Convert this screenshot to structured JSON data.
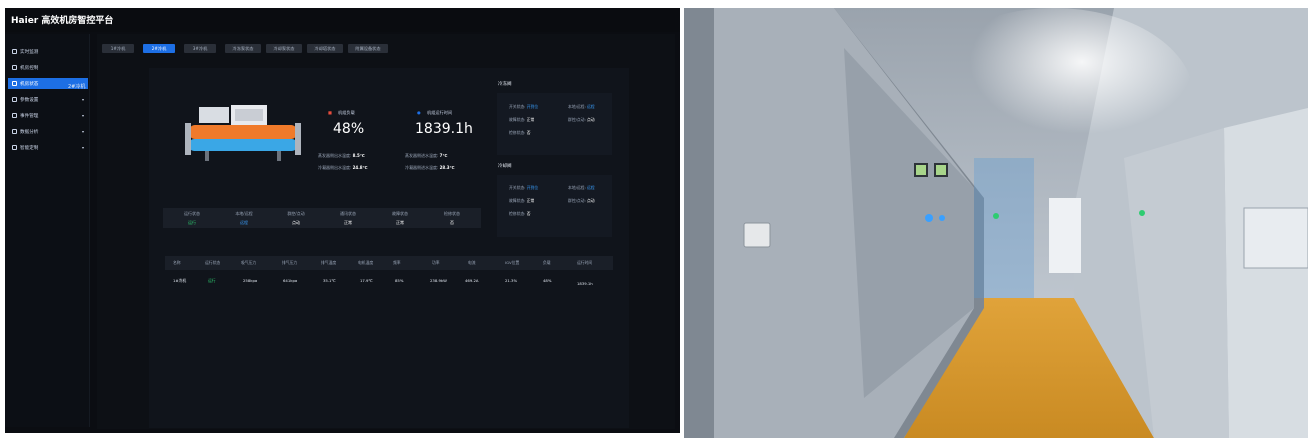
{
  "app": {
    "title": "Haier 高效机房智控平台"
  },
  "sidebar": {
    "items": [
      {
        "label": "实时监测",
        "has_arrow": false,
        "icon": "monitor-icon"
      },
      {
        "label": "机房控制",
        "has_arrow": false,
        "icon": "control-icon"
      },
      {
        "label": "机房状态",
        "has_arrow": false,
        "icon": "status-icon",
        "active": true
      },
      {
        "label": "参数设置",
        "has_arrow": true,
        "icon": "settings-icon"
      },
      {
        "label": "事件管理",
        "has_arrow": true,
        "icon": "event-icon"
      },
      {
        "label": "数据分析",
        "has_arrow": true,
        "icon": "analysis-icon"
      },
      {
        "label": "智能定制",
        "has_arrow": true,
        "icon": "custom-icon"
      }
    ]
  },
  "tabs": [
    {
      "label": "1#冷机"
    },
    {
      "label": "2#冷机",
      "active": true
    },
    {
      "label": "3#冷机"
    },
    {
      "label": "冷冻泵状态"
    },
    {
      "label": "冷却泵状态"
    },
    {
      "label": "冷却塔状态"
    },
    {
      "label": "附属设备状态"
    }
  ],
  "unit": {
    "title": "2#冷机",
    "load_label": "机组负载",
    "load_value": "48%",
    "runtime_label": "机组运行时间",
    "runtime_value": "1839.1h",
    "temps": {
      "evap_out_label": "蒸发器侧出水温度:",
      "evap_out_value": "8.5℃",
      "evap_in_label": "蒸发器侧进水温度:",
      "evap_in_value": "7℃",
      "cond_out_label": "冷凝器侧出水温度:",
      "cond_out_value": "24.8℃",
      "cond_in_label": "冷凝器侧进水温度:",
      "cond_in_value": "28.3℃"
    },
    "states": [
      {
        "label": "运行状态",
        "value": "运行"
      },
      {
        "label": "本地/远程",
        "value": "远程"
      },
      {
        "label": "群控/点动",
        "value": "点动"
      },
      {
        "label": "通讯状态",
        "value": "正常"
      },
      {
        "label": "故障状态",
        "value": "正常"
      },
      {
        "label": "检修状态",
        "value": "否"
      }
    ]
  },
  "valves": [
    {
      "title": "冷冻阀",
      "switch_label": "开关状态:",
      "switch_value": "开到位",
      "local_label": "本地/远程:",
      "local_value": "远程",
      "fault_label": "故障状态:",
      "fault_value": "正常",
      "group_label": "群控/点动:",
      "group_value": "点动",
      "repair_label": "检修状态:",
      "repair_value": "否"
    },
    {
      "title": "冷却阀",
      "switch_label": "开关状态:",
      "switch_value": "开到位",
      "local_label": "本地/远程:",
      "local_value": "远程",
      "fault_label": "故障状态:",
      "fault_value": "正常",
      "group_label": "群控/点动:",
      "group_value": "点动",
      "repair_label": "检修状态:",
      "repair_value": "否"
    }
  ],
  "table": {
    "headers": [
      "名称",
      "运行状态",
      "吸气压力",
      "排气压力",
      "排气温度",
      "电机温度",
      "频率",
      "功率",
      "电流",
      "IGV位置",
      "负载",
      "运行时间"
    ],
    "row": [
      "1#冷机",
      "运行",
      "258kpa",
      "641kpa",
      "35.1℃",
      "17.9℃",
      "85%",
      "238.9kW",
      "469.2A",
      "21.3%",
      "48%",
      "1839.1h"
    ]
  },
  "colors": {
    "accent": "#1d6fe5",
    "run_green": "#2ecc71",
    "value_blue": "#3aa0ff",
    "background": "#0b0d12"
  },
  "photo": {
    "caption": ""
  }
}
